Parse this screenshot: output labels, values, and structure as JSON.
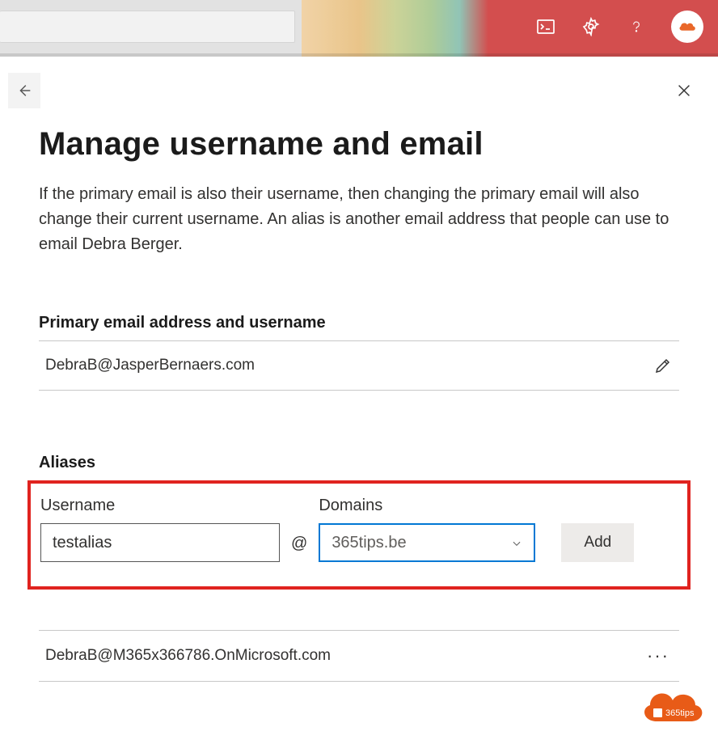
{
  "header": {
    "search_placeholder": ""
  },
  "page": {
    "title": "Manage username and email",
    "description": "If the primary email is also their username, then changing the primary email will also change their current username. An alias is another email address that people can use to email Debra Berger."
  },
  "primary_section": {
    "heading": "Primary email address and username",
    "value": "DebraB@JasperBernaers.com"
  },
  "aliases_section": {
    "heading": "Aliases",
    "username_label": "Username",
    "username_value": "testalias",
    "at": "@",
    "domains_label": "Domains",
    "domain_selected": "365tips.be",
    "add_label": "Add",
    "existing_alias": "DebraB@M365x366786.OnMicrosoft.com",
    "more_label": "···"
  },
  "badge": {
    "text": "365tips"
  }
}
